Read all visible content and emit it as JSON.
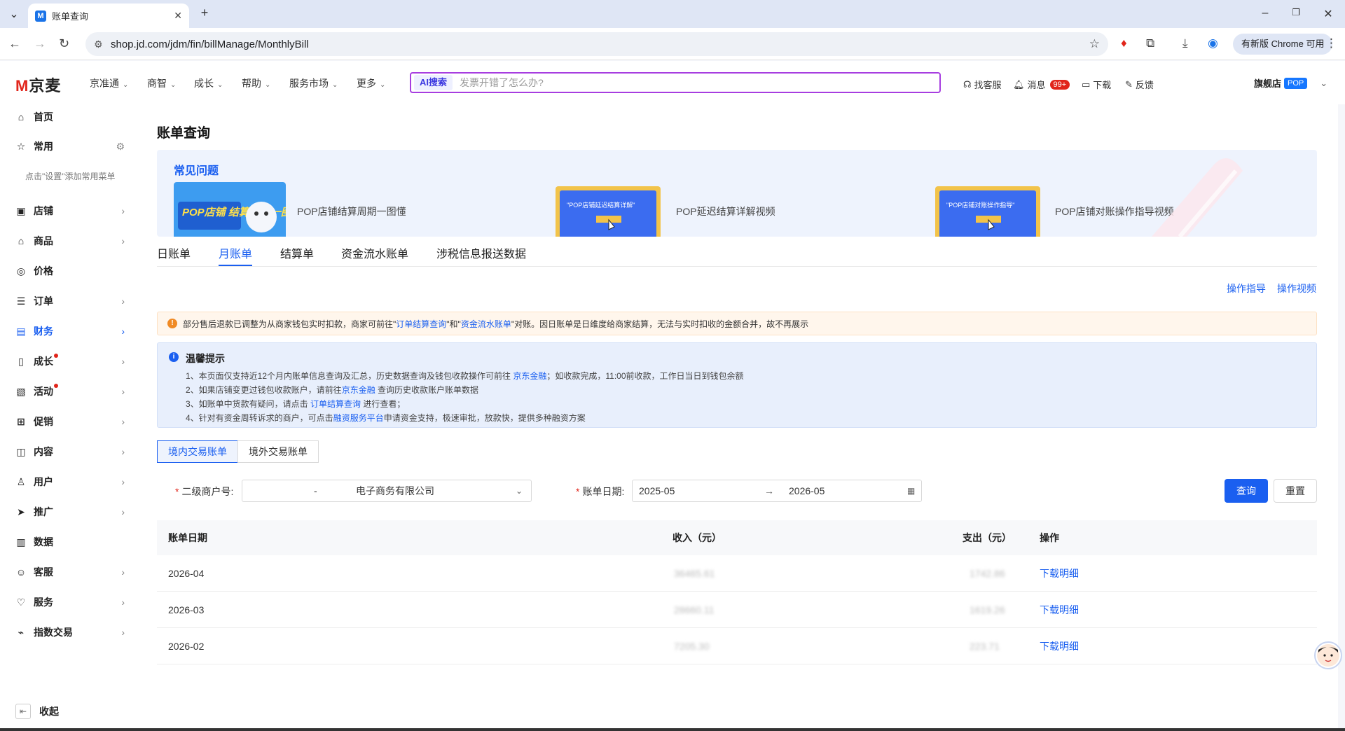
{
  "browser": {
    "tab_title": "账单查询",
    "tab_favicon": "M",
    "url": "shop.jd.com/jdm/fin/billManage/MonthlyBill",
    "chrome_update_label": "有新版 Chrome 可用"
  },
  "header": {
    "logo_m": "M",
    "logo_text": "京麦",
    "nav": [
      "京准通",
      "商智",
      "成长",
      "帮助",
      "服务市场",
      "更多"
    ],
    "search_badge": "AI搜索",
    "search_placeholder": "发票开错了怎么办?",
    "tools": {
      "service": "找客服",
      "messages": "消息",
      "message_count": "99+",
      "download": "下载",
      "feedback": "反馈"
    },
    "store_name": "旗舰店",
    "store_badge": "POP"
  },
  "sidebar": {
    "home": "首页",
    "common": "常用",
    "hint": "点击\"设置\"添加常用菜单",
    "items": [
      {
        "label": "店铺",
        "icon": "store-icon"
      },
      {
        "label": "商品",
        "icon": "goods-icon"
      },
      {
        "label": "价格",
        "icon": "price-icon"
      },
      {
        "label": "订单",
        "icon": "order-icon"
      },
      {
        "label": "财务",
        "icon": "finance-icon"
      },
      {
        "label": "成长",
        "icon": "growth-icon"
      },
      {
        "label": "活动",
        "icon": "activity-icon"
      },
      {
        "label": "促销",
        "icon": "promotion-icon"
      },
      {
        "label": "内容",
        "icon": "content-icon"
      },
      {
        "label": "用户",
        "icon": "user-icon"
      },
      {
        "label": "推广",
        "icon": "promote-icon"
      },
      {
        "label": "数据",
        "icon": "data-icon"
      },
      {
        "label": "客服",
        "icon": "service-icon"
      },
      {
        "label": "服务",
        "icon": "heart-icon"
      },
      {
        "label": "指数交易",
        "icon": "index-trade-icon"
      }
    ],
    "collapse": "收起"
  },
  "page": {
    "title": "账单查询",
    "faq": {
      "title": "常见问题",
      "cards": [
        {
          "label": "POP店铺结算周期一图懂",
          "image_text": "POP店铺 结算周期一图懂"
        },
        {
          "label": "POP延迟结算详解视频",
          "image_text": "\"POP店铺延迟结算详解\""
        },
        {
          "label": "POP店铺对账操作指导视频",
          "image_text": "\"POP店铺对账操作指导\""
        }
      ]
    },
    "tabs": [
      "日账单",
      "月账单",
      "结算单",
      "资金流水账单",
      "涉税信息报送数据"
    ],
    "links": {
      "guide": "操作指导",
      "video": "操作视频"
    },
    "alert": {
      "p1": "部分售后退款已调整为从商家钱包实时扣款，商家可前往\"",
      "link1": "订单结算查询",
      "p2": "\"和\"",
      "link2": "资金流水账单",
      "p3": "\"对账。因日账单是日维度给商家结算，无法与实时扣收的金额合并，故不再展示"
    },
    "tips": {
      "title": "温馨提示",
      "l1a": "1、本页面仅支持近12个月内账单信息查询及汇总，历史数据查询及钱包收款操作可前往 ",
      "l1link": "京东金融",
      "l1b": "；如收款完成，11:00前收款，工作日当日到钱包余额",
      "l2a": "2、如果店铺变更过钱包收款账户，请前往",
      "l2link": "京东金融",
      "l2b": " 查询历史收款账户账单数据",
      "l3a": "3、如账单中货款有疑问，请点击 ",
      "l3link": "订单结算查询",
      "l3b": " 进行查看；",
      "l4a": "4、针对有资金周转诉求的商户，可点击",
      "l4link": "融资服务平台",
      "l4b": "申请资金支持，极速审批，放款快，提供多种融资方案"
    },
    "seg": [
      "境内交易账单",
      "境外交易账单"
    ],
    "filter": {
      "merchant_label": "二级商户号:",
      "merchant_sep": "-",
      "merchant_value": "电子商务有限公司",
      "date_label": "账单日期:",
      "date_start": "2025-05",
      "date_arrow": "→",
      "date_end": "2026-05",
      "query": "查询",
      "reset": "重置"
    },
    "table": {
      "headers": [
        "账单日期",
        "收入（元）",
        "支出（元）",
        "操作"
      ],
      "rows": [
        {
          "date": "2026-04",
          "income": "36465.61",
          "expense": "1742.86",
          "action": "下载明细"
        },
        {
          "date": "2026-03",
          "income": "28660.11",
          "expense": "1619.26",
          "action": "下载明细"
        },
        {
          "date": "2026-02",
          "income": "7205.30",
          "expense": "223.71",
          "action": "下载明细"
        }
      ]
    }
  }
}
